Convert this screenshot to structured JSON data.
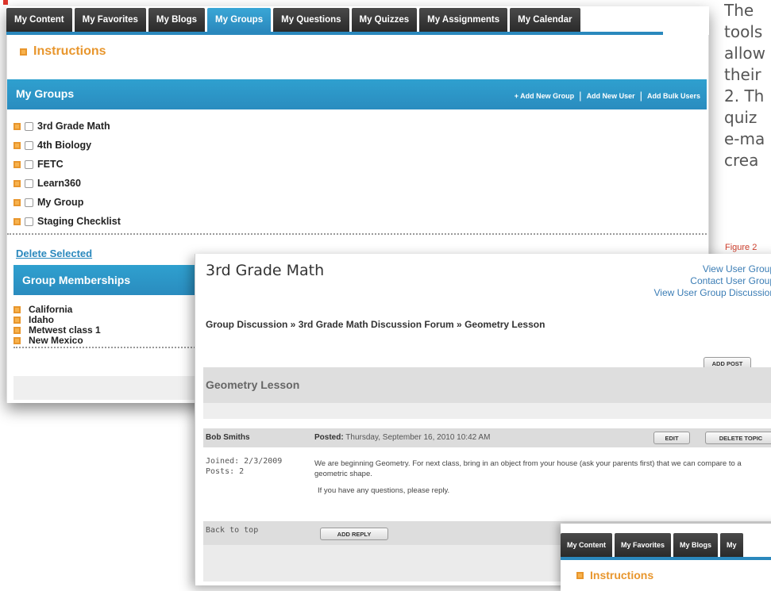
{
  "side_text": [
    "The",
    "tools",
    "allow",
    "their",
    "2. Th",
    "quiz",
    "e-ma",
    "crea"
  ],
  "figure_caption": "Figure 2",
  "panel1": {
    "tabs": [
      "My Content",
      "My Favorites",
      "My Blogs",
      "My Groups",
      "My Questions",
      "My Quizzes",
      "My Assignments",
      "My Calendar"
    ],
    "active_tab": "My Groups",
    "instructions": "Instructions",
    "my_groups_title": "My Groups",
    "actions": [
      "+ Add New Group",
      "Add New User",
      "Add Bulk Users"
    ],
    "groups": [
      "3rd Grade Math",
      "4th Biology",
      "FETC",
      "Learn360",
      "My Group",
      "Staging Checklist"
    ],
    "delete_selected": "Delete Selected",
    "memberships_title": "Group Memberships",
    "memberships": [
      "California",
      "Idaho",
      "Metwest class 1",
      "New Mexico"
    ]
  },
  "panel2": {
    "title": "3rd Grade Math",
    "links": [
      "View User Group",
      "Contact User Group",
      "View User Group Discussion"
    ],
    "breadcrumb": "Group Discussion » 3rd Grade Math Discussion Forum » Geometry Lesson",
    "add_post": "ADD POST",
    "post_title": "Geometry Lesson",
    "author": "Bob Smiths",
    "posted_label": "Posted:",
    "posted_date": "Thursday, September 16, 2010 10:42 AM",
    "edit": "EDIT",
    "delete_topic": "DELETE TOPIC",
    "joined": "Joined: 2/3/2009",
    "posts": "Posts: 2",
    "body_1": "We are beginning Geometry. For next class, bring in an object from your house (ask your parents first) that we can compare to a geometric shape.",
    "body_2": "If you have any questions, please reply.",
    "back_to_top": "Back to top",
    "add_reply": "ADD REPLY"
  },
  "panel3": {
    "tabs": [
      "My Content",
      "My Favorites",
      "My Blogs",
      "My"
    ],
    "instructions": "Instructions"
  },
  "colors": {
    "accent_blue": "#2a88bd",
    "orange": "#e8962d",
    "tab_dark": "#333333"
  }
}
